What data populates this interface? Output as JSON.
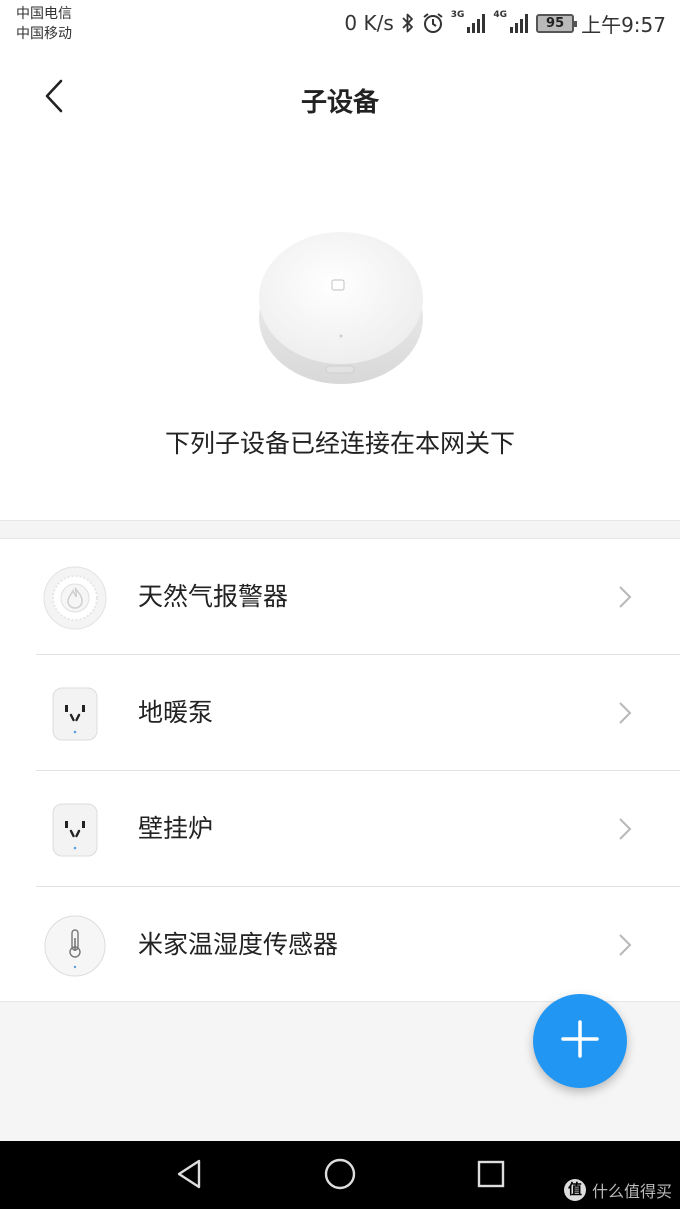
{
  "status_bar": {
    "carrier_1": "中国电信",
    "carrier_2": "中国移动",
    "net_speed": "0 K/s",
    "sim1_network": "3G",
    "sim2_network": "4G",
    "battery_level": "95",
    "time": "上午9:57"
  },
  "header": {
    "title": "子设备",
    "back_icon": "chevron-left-icon"
  },
  "gateway": {
    "description": "下列子设备已经连接在本网关下"
  },
  "devices": [
    {
      "name": "天然气报警器",
      "icon": "gas-alarm-icon"
    },
    {
      "name": "地暖泵",
      "icon": "smart-plug-icon"
    },
    {
      "name": "壁挂炉",
      "icon": "smart-plug-icon"
    },
    {
      "name": "米家温湿度传感器",
      "icon": "thermometer-sensor-icon"
    }
  ],
  "fab": {
    "icon": "plus-icon",
    "color": "#2196f3"
  },
  "watermark": {
    "logo_text": "值",
    "text": "什么值得买"
  },
  "colors": {
    "accent": "#2196f3",
    "band_bg": "#f4f4f4",
    "nav_bg": "#000000"
  }
}
